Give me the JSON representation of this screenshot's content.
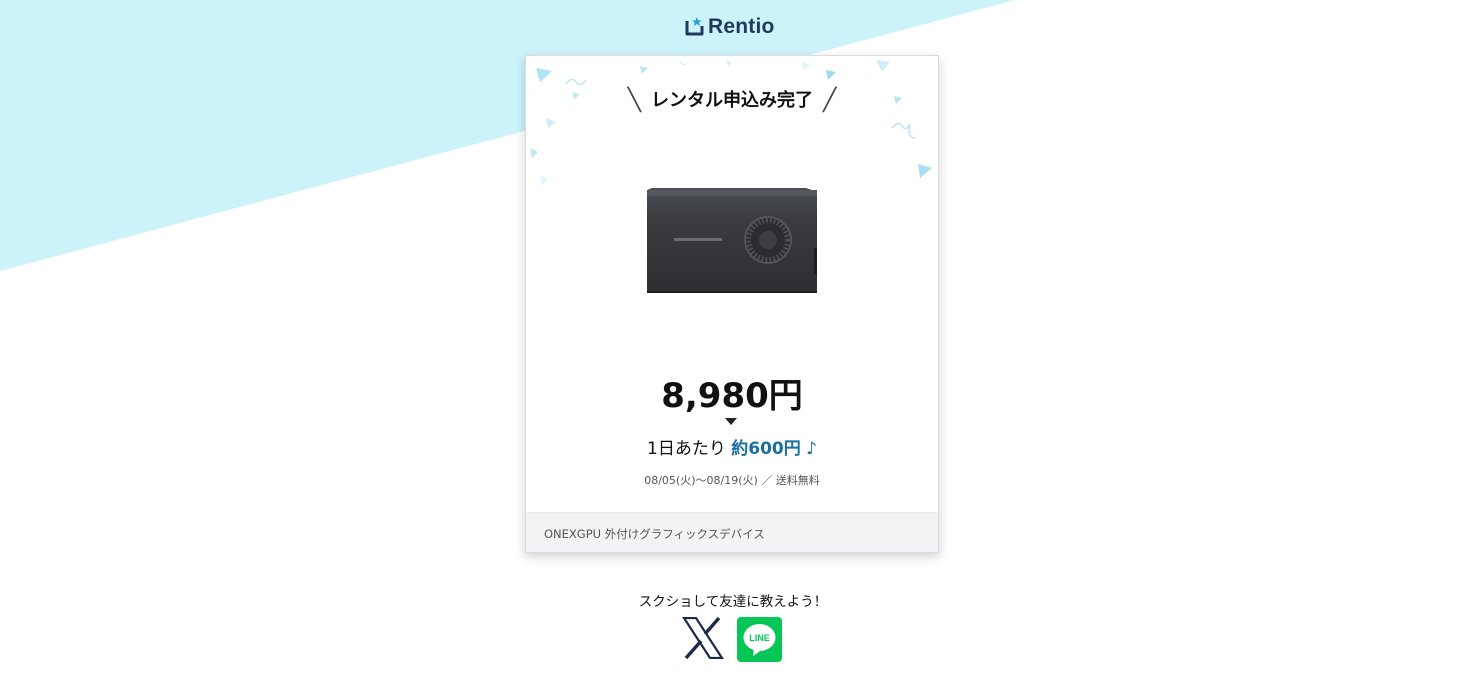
{
  "brand": {
    "name": "Rentio",
    "logo_color": "#1f3b5c",
    "logo_icon_color": "#2a9fd6"
  },
  "card": {
    "title": "レンタル申込み完了",
    "price": "8,980円",
    "per_day_prefix": "1日あたり",
    "per_day_value": "約600円",
    "per_day_note": "♪",
    "period": "08/05(火)〜08/19(火) ／ 送料無料",
    "product_name": "ONEXGPU 外付けグラフィックスデバイス",
    "product_image": "onexgpu-device-image",
    "accent_color": "#1a6fa0"
  },
  "share": {
    "prompt": "スクショして友達に教えよう！",
    "x_icon": "x-logo-icon",
    "line_icon": "line-logo-icon",
    "line_label": "LINE",
    "line_color": "#06c755"
  },
  "background": {
    "band_color": "#ccf2fa"
  }
}
